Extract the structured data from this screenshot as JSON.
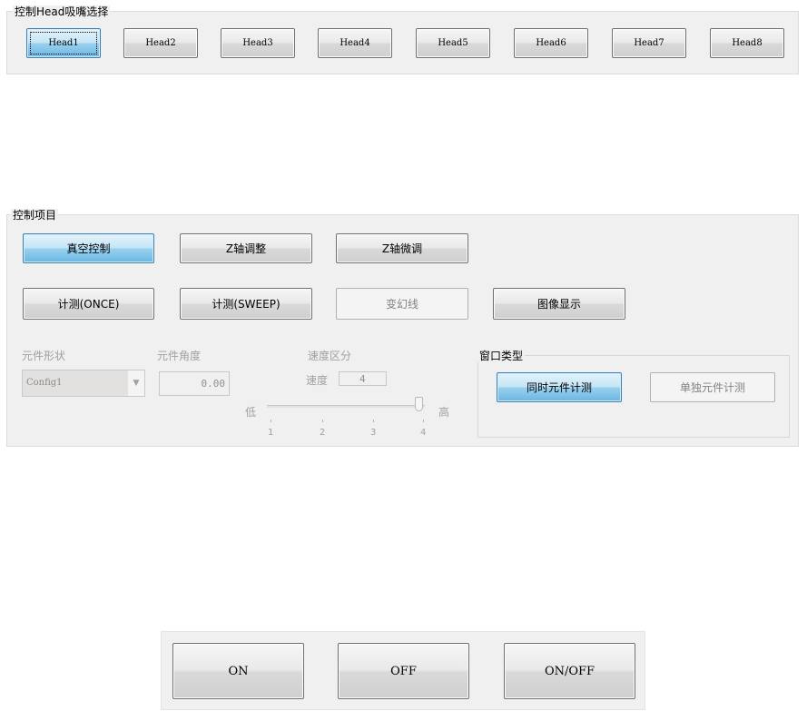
{
  "head_group": {
    "title": "控制Head吸嘴选择",
    "buttons": [
      "Head1",
      "Head2",
      "Head3",
      "Head4",
      "Head5",
      "Head6",
      "Head7",
      "Head8"
    ],
    "selected": "Head1"
  },
  "control_group": {
    "title": "控制项目",
    "row1": [
      "真空控制",
      "Z轴调整",
      "Z轴微调"
    ],
    "row2": [
      "计测(ONCE)",
      "计测(SWEEP)",
      "变幻线",
      "图像显示"
    ],
    "selected": "真空控制",
    "disabled": [
      "变幻线"
    ],
    "shape": {
      "label": "元件形状",
      "value": "Config1"
    },
    "angle": {
      "label": "元件角度",
      "value": "0.00"
    },
    "speed": {
      "label": "速度区分",
      "speed_label": "速度",
      "speed_value": "4",
      "low_label": "低",
      "high_label": "高",
      "ticks": [
        "1",
        "2",
        "3",
        "4"
      ],
      "value": 4,
      "min": 1,
      "max": 4
    },
    "window_type": {
      "title": "窗口类型",
      "buttons": [
        "同时元件计测",
        "单独元件计测"
      ],
      "selected": "同时元件计测",
      "disabled": [
        "单独元件计测"
      ]
    }
  },
  "onoff_group": {
    "buttons": [
      "ON",
      "OFF",
      "ON/OFF"
    ]
  }
}
